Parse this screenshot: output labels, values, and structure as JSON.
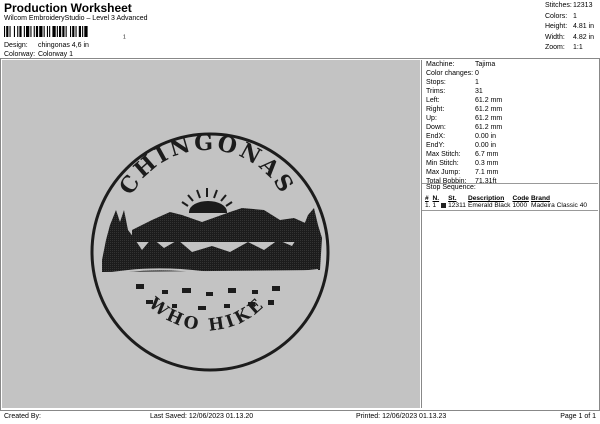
{
  "header": {
    "title": "Production Worksheet",
    "subtitle": "Wilcom EmbroideryStudio – Level 3 Advanced",
    "barcode_check": "1"
  },
  "meta": {
    "design_label": "Design:",
    "design_value": "chingonas 4,6 in",
    "colorway_label": "Colorway:",
    "colorway_value": "Colorway 1"
  },
  "stats": [
    {
      "label": "Stitches:",
      "value": "12313"
    },
    {
      "label": "Colors:",
      "value": "1"
    },
    {
      "label": "Height:",
      "value": "4.81 in"
    },
    {
      "label": "Width:",
      "value": "4.82 in"
    },
    {
      "label": "Zoom:",
      "value": "1:1"
    }
  ],
  "design_preview": {
    "top_text": "CHINGONAS",
    "bottom_text": "WHO HIKE",
    "thread_color": "#1c1c1c",
    "background_color": "#c3c3c3"
  },
  "machine_info": [
    {
      "label": "Machine:",
      "value": "Tajima"
    },
    {
      "label": "Color changes:",
      "value": "0"
    },
    {
      "label": "Stops:",
      "value": "1"
    },
    {
      "label": "Trims:",
      "value": "31"
    },
    {
      "label": "Left:",
      "value": "61.2 mm"
    },
    {
      "label": "Right:",
      "value": "61.2 mm"
    },
    {
      "label": "Up:",
      "value": "61.2 mm"
    },
    {
      "label": "Down:",
      "value": "61.2 mm"
    },
    {
      "label": "EndX:",
      "value": "0.00 in"
    },
    {
      "label": "EndY:",
      "value": "0.00 in"
    },
    {
      "label": "Max Stitch:",
      "value": "6.7 mm"
    },
    {
      "label": "Min Stitch:",
      "value": "0.3 mm"
    },
    {
      "label": "Max Jump:",
      "value": "7.1 mm"
    },
    {
      "label": "Total Bobbin:",
      "value": "71.31ft"
    }
  ],
  "stop_sequence": {
    "title": "Stop Sequence:",
    "headers": [
      "#",
      "N.",
      "St.",
      "Description",
      "Code",
      "Brand"
    ],
    "rows": [
      {
        "num": "1.",
        "n": "1",
        "st": "12311",
        "description": "Emerald Black",
        "code": "1000",
        "brand": "Madeira Classic 40"
      }
    ]
  },
  "footer": {
    "created_by": "Created By:",
    "last_saved": "Last Saved: 12/06/2023 01.13.20",
    "printed": "Printed: 12/06/2023 01.13.23",
    "page": "Page 1 of 1"
  }
}
